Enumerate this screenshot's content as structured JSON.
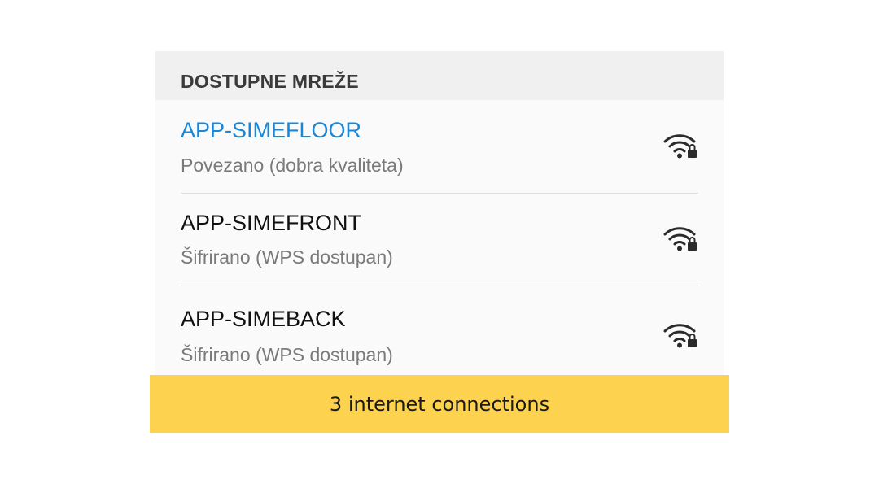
{
  "section": {
    "title": "DOSTUPNE MREŽE"
  },
  "networks": [
    {
      "name": "APP-SIMEFLOOR",
      "status": "Povezano (dobra kvaliteta)",
      "connected": true,
      "icon": "wifi-lock-icon"
    },
    {
      "name": "APP-SIMEFRONT",
      "status": "Šifrirano (WPS dostupan)",
      "connected": false,
      "icon": "wifi-lock-icon"
    },
    {
      "name": "APP-SIMEBACK",
      "status": "Šifrirano (WPS dostupan)",
      "connected": false,
      "icon": "wifi-lock-icon"
    }
  ],
  "banner": {
    "text": "3 internet connections"
  },
  "colors": {
    "connected_accent": "#1c86d6",
    "banner_background": "#fcd24f",
    "header_background": "#f0f0f0"
  }
}
